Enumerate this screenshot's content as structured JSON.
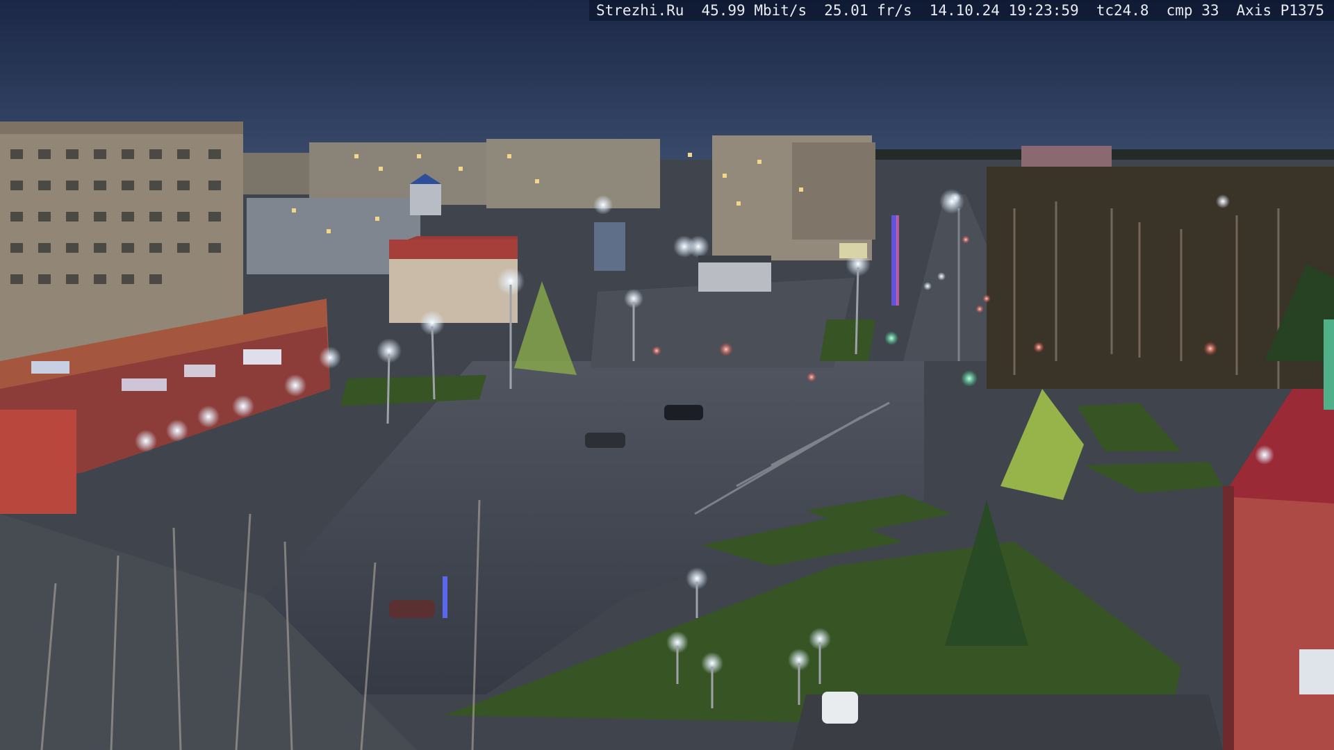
{
  "overlay": {
    "site": "Strezhi.Ru",
    "bitrate": "45.99 Mbit/s",
    "framerate": "25.01 fr/s",
    "datetime": "14.10.24 19:23:59",
    "temperature": "tc24.8",
    "compression": "cmp 33",
    "camera": "Axis P1375"
  },
  "scene": {
    "sky_color_top": "#1d2a4a",
    "sky_color_horizon": "#34466a",
    "road_color": "#3e4450",
    "grass_color": "#3a5a2a",
    "lamp_color": "#eaf4ff",
    "traffic_red": "#ff3a2a",
    "traffic_green": "#36ff9a"
  }
}
